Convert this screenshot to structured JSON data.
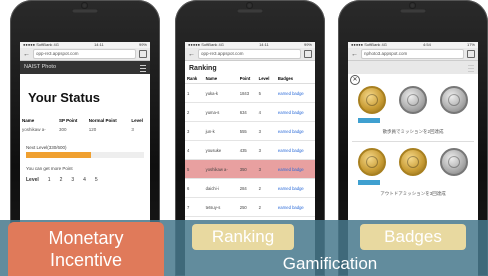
{
  "phone1": {
    "status": {
      "carrier": "●●●●● SoftBank 4G",
      "time": "14:11",
      "battery": "99%"
    },
    "url": "opp-re3.appspot.com",
    "appbar_title": "NAIST Photo",
    "page_title": "Your Status",
    "table_headers": [
      "Name",
      "SP Point",
      "Normal Point",
      "Level"
    ],
    "table_row": [
      "yoshikaw a-",
      "300",
      "120",
      "3"
    ],
    "next_level": "Next Level(330/600)",
    "progress": 0.55,
    "get_more": "You can get more Point",
    "levels_label": "Level",
    "levels": [
      "1",
      "2",
      "3",
      "4",
      "5"
    ]
  },
  "phone2": {
    "status": {
      "carrier": "●●●●● SoftBank 4G",
      "time": "14:11",
      "battery": "99%"
    },
    "url": "opp-re3.appspot.com",
    "heading": "Ranking",
    "headers": [
      "Rank",
      "Name",
      "Point",
      "Level",
      "Badges"
    ],
    "rows": [
      [
        "1",
        "yuka-k",
        "1843",
        "5",
        "earned badge"
      ],
      [
        "2",
        "yuma-s",
        "634",
        "4",
        "earned badge"
      ],
      [
        "3",
        "jun-k",
        "555",
        "3",
        "earned badge"
      ],
      [
        "4",
        "yousuke",
        "435",
        "3",
        "earned badge"
      ],
      [
        "5",
        "yoshikaw a-",
        "350",
        "3",
        "earned badge"
      ],
      [
        "6",
        "daichi-i",
        "284",
        "2",
        "earned badge"
      ],
      [
        "7",
        "tetsuy-s",
        "250",
        "2",
        "earned badge"
      ]
    ]
  },
  "phone3": {
    "status": {
      "carrier": "●●●●● SoftBank 4G",
      "time": "4:54",
      "battery": "17%"
    },
    "url": "nphoto3.appspot.com",
    "caption1": "散歩員でミッションを2回達成",
    "caption2": "アウトドアミッションを3回達成"
  },
  "labels": {
    "monetary": "Monetary",
    "incentive": "Incentive",
    "ranking": "Ranking",
    "badges": "Badges",
    "gamification": "Gamification"
  }
}
